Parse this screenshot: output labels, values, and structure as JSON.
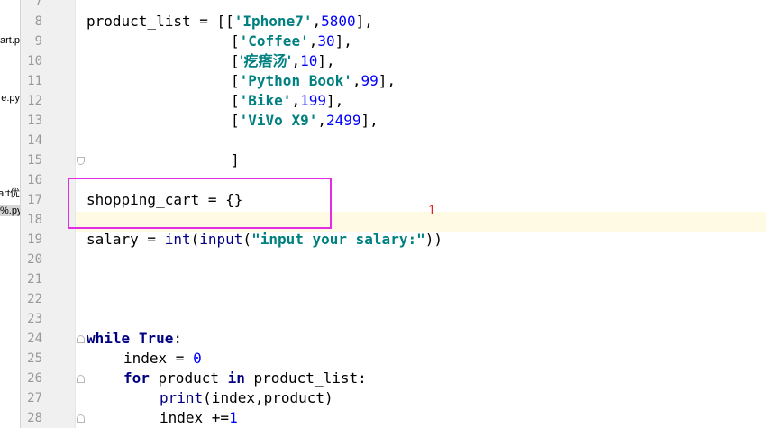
{
  "project_files": [
    "art.p",
    "e.py",
    "art优",
    "%.py"
  ],
  "line_numbers": [
    "7",
    "8",
    "9",
    "10",
    "11",
    "12",
    "13",
    "14",
    "15",
    "16",
    "17",
    "18",
    "19",
    "20",
    "21",
    "22",
    "23",
    "24",
    "25",
    "26",
    "27",
    "28"
  ],
  "code": {
    "l8": {
      "a": "product_list = [[",
      "b": "'Iphone7'",
      "c": ",",
      "d": "5800",
      "e": "],"
    },
    "l9": {
      "a": "[",
      "b": "'Coffee'",
      "c": ",",
      "d": "30",
      "e": "],"
    },
    "l10": {
      "a": "[",
      "b": "'疙瘩汤'",
      "c": ",",
      "d": "10",
      "e": "],"
    },
    "l11": {
      "a": "[",
      "b": "'Python Book'",
      "c": ",",
      "d": "99",
      "e": "],"
    },
    "l12": {
      "a": "[",
      "b": "'Bike'",
      "c": ",",
      "d": "199",
      "e": "],"
    },
    "l13": {
      "a": "[",
      "b": "'ViVo X9'",
      "c": ",",
      "d": "2499",
      "e": "],"
    },
    "l15": {
      "a": "]"
    },
    "l17": {
      "a": "shopping_cart = {}"
    },
    "l19": {
      "a": "salary = ",
      "b": "int",
      "c": "(",
      "d": "input",
      "e": "(",
      "f": "\"input your salary:\"",
      "g": "))"
    },
    "l24": {
      "a": "while",
      "b": " ",
      "c": "True",
      "d": ":"
    },
    "l25": {
      "a": "index = ",
      "b": "0"
    },
    "l26": {
      "a": "for",
      "b": " product ",
      "c": "in",
      "d": " product_list:"
    },
    "l27": {
      "a": "print",
      "b": "(index,product)"
    },
    "l28": {
      "a": "index +=",
      "b": "1"
    }
  },
  "annotation_number": "1",
  "colors": {
    "highlight_box": "#e02ee0",
    "annotation": "#e0201e",
    "string": "#008080",
    "number": "#0000ff",
    "keyword": "#000080",
    "caret_line": "#fffae3"
  }
}
